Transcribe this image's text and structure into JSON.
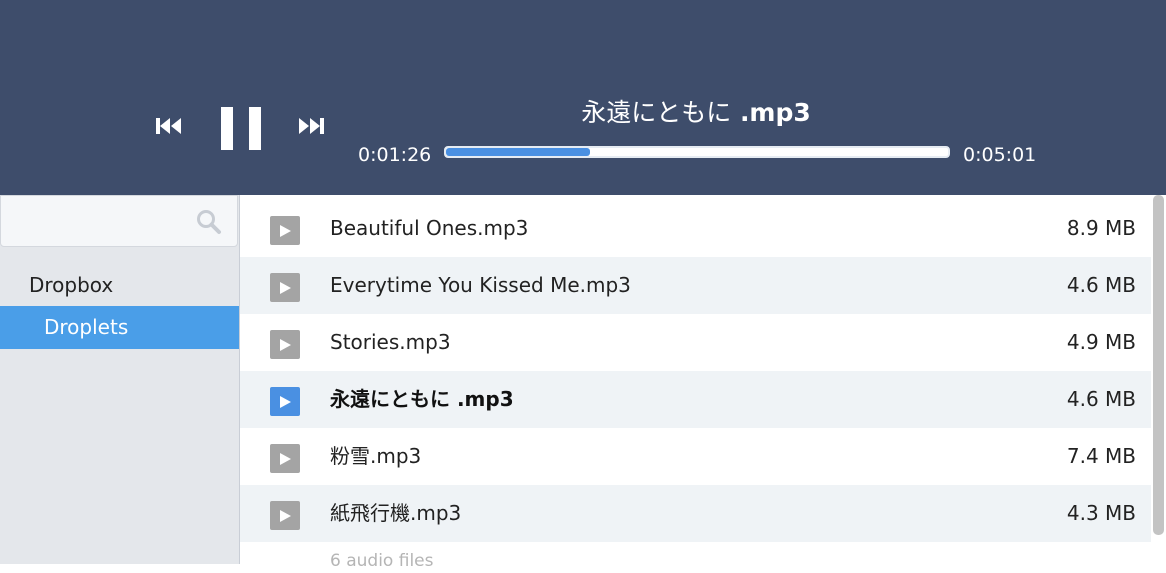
{
  "player": {
    "title_main": "永遠にともに",
    "title_ext": " .mp3",
    "current_time": "0:01:26",
    "total_time": "0:05:01",
    "progress_fraction": 0.286,
    "controls": {
      "prev_icon": "skip-previous-icon",
      "pause_icon": "pause-icon",
      "next_icon": "skip-next-icon"
    }
  },
  "sidebar": {
    "search": {
      "value": "",
      "placeholder": "",
      "icon": "search-icon"
    },
    "root_label": "Dropbox",
    "active_label": "Droplets"
  },
  "files": [
    {
      "name": "Beautiful Ones.mp3",
      "size": "8.9 MB",
      "playing": false
    },
    {
      "name": "Everytime You Kissed Me.mp3",
      "size": "4.6 MB",
      "playing": false
    },
    {
      "name": "Stories.mp3",
      "size": "4.9 MB",
      "playing": false
    },
    {
      "name": "永遠にともに .mp3",
      "size": "4.6 MB",
      "playing": true
    },
    {
      "name": "粉雪.mp3",
      "size": "7.4 MB",
      "playing": false
    },
    {
      "name": "紙飛行機.mp3",
      "size": "4.3 MB",
      "playing": false
    }
  ],
  "file_count_label": "6 audio files",
  "colors": {
    "header_bg": "#3e4d6b",
    "accent": "#4a90e2",
    "sidebar_active": "#4a9ee8",
    "row_alt": "#eff3f6",
    "play_idle": "#a4a4a4"
  }
}
